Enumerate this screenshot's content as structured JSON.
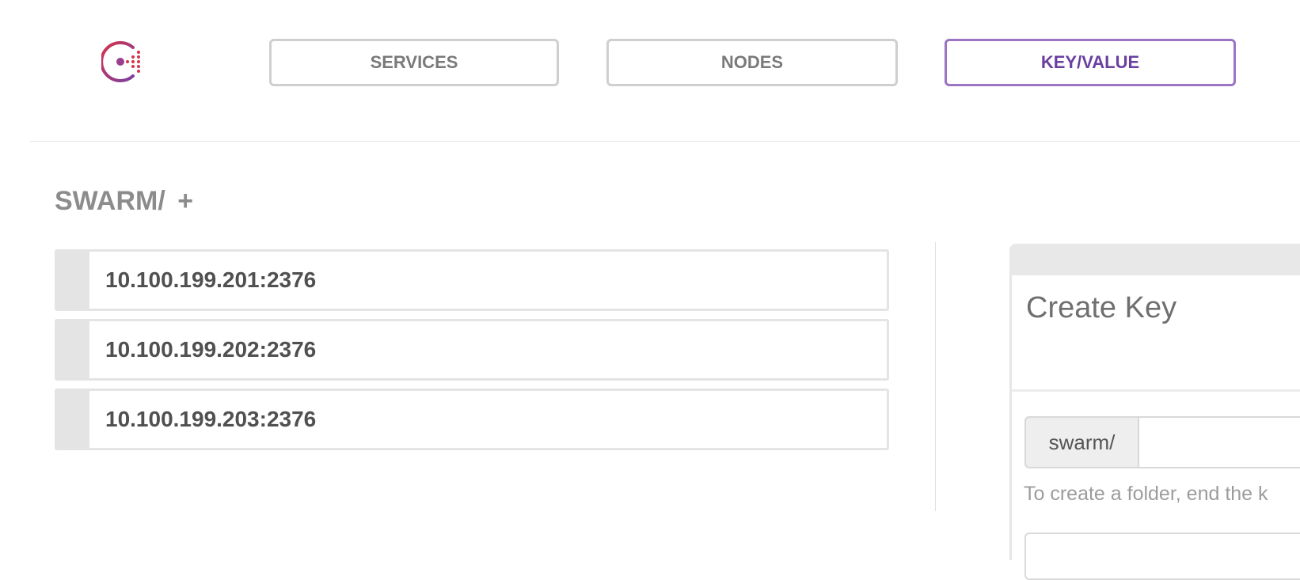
{
  "nav": {
    "services": "SERVICES",
    "nodes": "NODES",
    "key_value": "KEY/VALUE"
  },
  "colors": {
    "accent": "#6a3fa0",
    "logo_dots": "#d6334b"
  },
  "heading": {
    "title": "SWARM/",
    "add": "+"
  },
  "keys": [
    {
      "label": "10.100.199.201:2376"
    },
    {
      "label": "10.100.199.202:2376"
    },
    {
      "label": "10.100.199.203:2376"
    }
  ],
  "create_key": {
    "title": "Create Key",
    "prefix": "swarm/",
    "key_value": "",
    "help": "To create a folder, end the k"
  }
}
